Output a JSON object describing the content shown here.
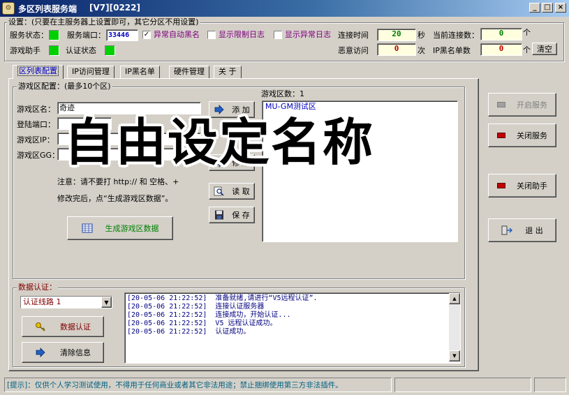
{
  "window": {
    "title": "多区列表服务端",
    "version": "[V7][0222]",
    "min_label": "_",
    "max_label": "□",
    "close_label": "×"
  },
  "settings": {
    "group_title": "设置：(只要在主服务器上设置即可，其它分区不用设置)",
    "service_status_label": "服务状态：",
    "service_port_label": "服务端口：",
    "service_port_value": "33446",
    "auto_blacklist_label": "异常自动黑名",
    "auto_blacklist_checked": true,
    "show_limit_log_label": "显示限制日志",
    "show_limit_log_checked": false,
    "show_abnormal_log_label": "显示异常日志",
    "show_abnormal_log_checked": false,
    "connect_time_label": "连接时间",
    "connect_time_value": "20",
    "connect_time_unit": "秒",
    "current_connections_label": "当前连接数：",
    "current_connections_value": "0",
    "current_connections_unit": "个",
    "game_helper_label": "游戏助手",
    "auth_status_label": "认证状态",
    "malicious_access_label": "恶意访问",
    "malicious_access_value": "0",
    "malicious_access_unit": "次",
    "ip_blacklist_count_label": "IP黑名单数",
    "ip_blacklist_count_value": "0",
    "ip_blacklist_count_unit": "个",
    "clear_button": "清空",
    "led_color": "#00d000"
  },
  "tabs": [
    {
      "label": "区列表配置",
      "active": true
    },
    {
      "label": "IP访问管理",
      "active": false
    },
    {
      "label": "IP黑名单",
      "active": false
    },
    {
      "label": "硬件管理",
      "active": false
    },
    {
      "label": "关 于",
      "active": false
    }
  ],
  "zone_config": {
    "group_title": "游戏区配置：(最多10个区)",
    "name_label": "游戏区名：",
    "name_value": "奇迹",
    "port_label": "登陆端口：",
    "ip_label": "游戏区IP：",
    "gg_label": "游戏区GG：",
    "add_button": "添 加",
    "modify_button": "修 改",
    "read_button": "读 取",
    "save_button": "保 存",
    "note_line1": "注意：请不要打 http:// 和 空格、+",
    "note_line2": "修改完后，点“生成游戏区数据”。",
    "generate_button": "生成游戏区数据",
    "zone_count_label": "游戏区数：1",
    "zone_list": [
      "MU-GM测试区"
    ]
  },
  "side_buttons": {
    "start_service": "开启服务",
    "stop_service": "关闭服务",
    "stop_helper": "关闭助手",
    "exit": "退  出"
  },
  "data_auth": {
    "group_title": "数据认证：",
    "route_select": "认证线路 1",
    "auth_button": "数据认证",
    "clear_button": "清除信息",
    "log_lines": [
      "[20-05-06 21:22:52]  准备就绪,请进行“V5远程认证”.",
      "[20-05-06 21:22:52]  连接认证服务器",
      "[20-05-06 21:22:52]  连接成功，开始认证...",
      "[20-05-06 21:22:52]  V5 远程认证成功。",
      "[20-05-06 21:22:52]  认证成功。"
    ]
  },
  "status_bar": {
    "tip": "[提示]：仅供个人学习测试使用，不得用于任何商业或者其它非法用途；禁止捆绑使用第三方非法插件。"
  },
  "overlay": {
    "text": "自由设定名称"
  }
}
